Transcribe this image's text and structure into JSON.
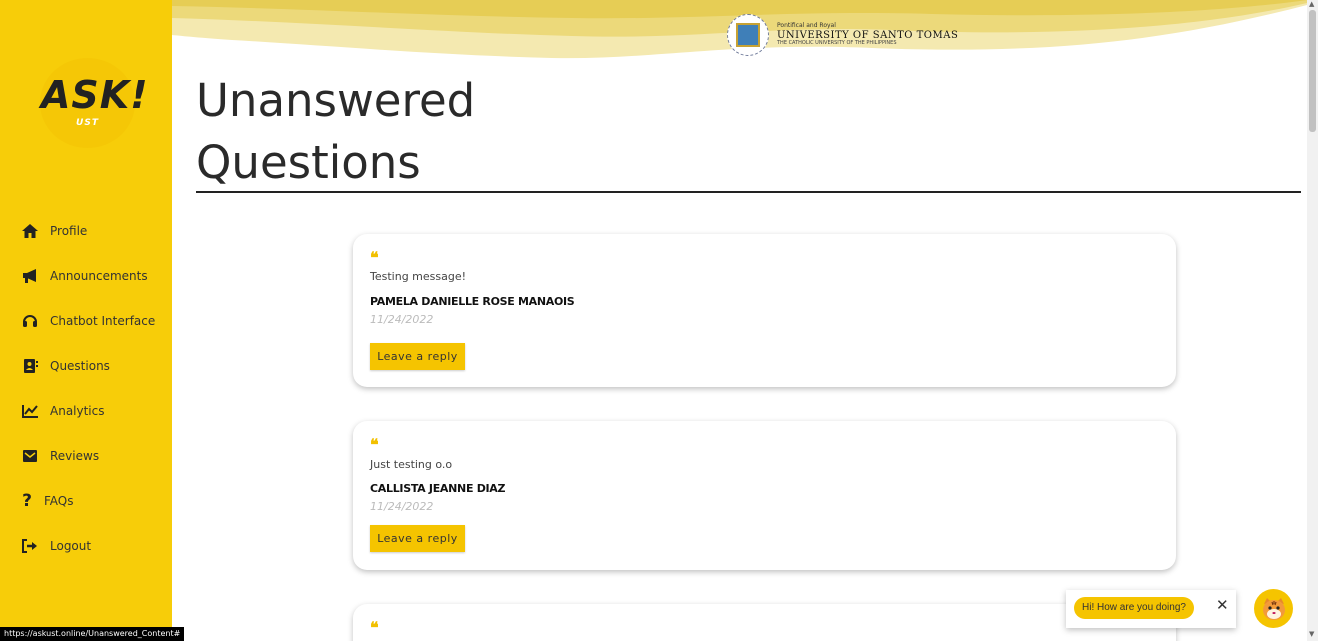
{
  "sidebar": {
    "logo_main": "ASK!",
    "logo_sub": "UST",
    "items": [
      {
        "label": "Profile",
        "icon": "home-icon"
      },
      {
        "label": "Announcements",
        "icon": "megaphone-icon"
      },
      {
        "label": "Chatbot Interface",
        "icon": "headset-icon"
      },
      {
        "label": "Questions",
        "icon": "contact-card-icon"
      },
      {
        "label": "Analytics",
        "icon": "line-chart-icon"
      },
      {
        "label": "Reviews",
        "icon": "envelope-icon"
      },
      {
        "label": "FAQs",
        "icon": "question-mark-icon"
      },
      {
        "label": "Logout",
        "icon": "sign-out-icon"
      }
    ]
  },
  "header": {
    "uni_line1": "Pontifical and Royal",
    "uni_line2": "UNIVERSITY OF SANTO TOMAS",
    "uni_line3": "THE CATHOLIC UNIVERSITY OF THE PHILIPPINES"
  },
  "page": {
    "title_line1": "Unanswered",
    "title_line2": "Questions"
  },
  "questions": [
    {
      "message": "Testing message!",
      "author": "PAMELA DANIELLE ROSE MANAOIS",
      "date": "11/24/2022",
      "reply_label": "Leave a reply"
    },
    {
      "message": "Just testing o.o",
      "author": "CALLISTA JEANNE DIAZ",
      "date": "11/24/2022",
      "reply_label": "Leave a reply"
    }
  ],
  "status_url": "https://askust.online/Unanswered_Content#",
  "chat": {
    "greeting": "Hi! How are you doing?"
  },
  "colors": {
    "accent": "#f7cd09",
    "button": "#f5c400"
  }
}
